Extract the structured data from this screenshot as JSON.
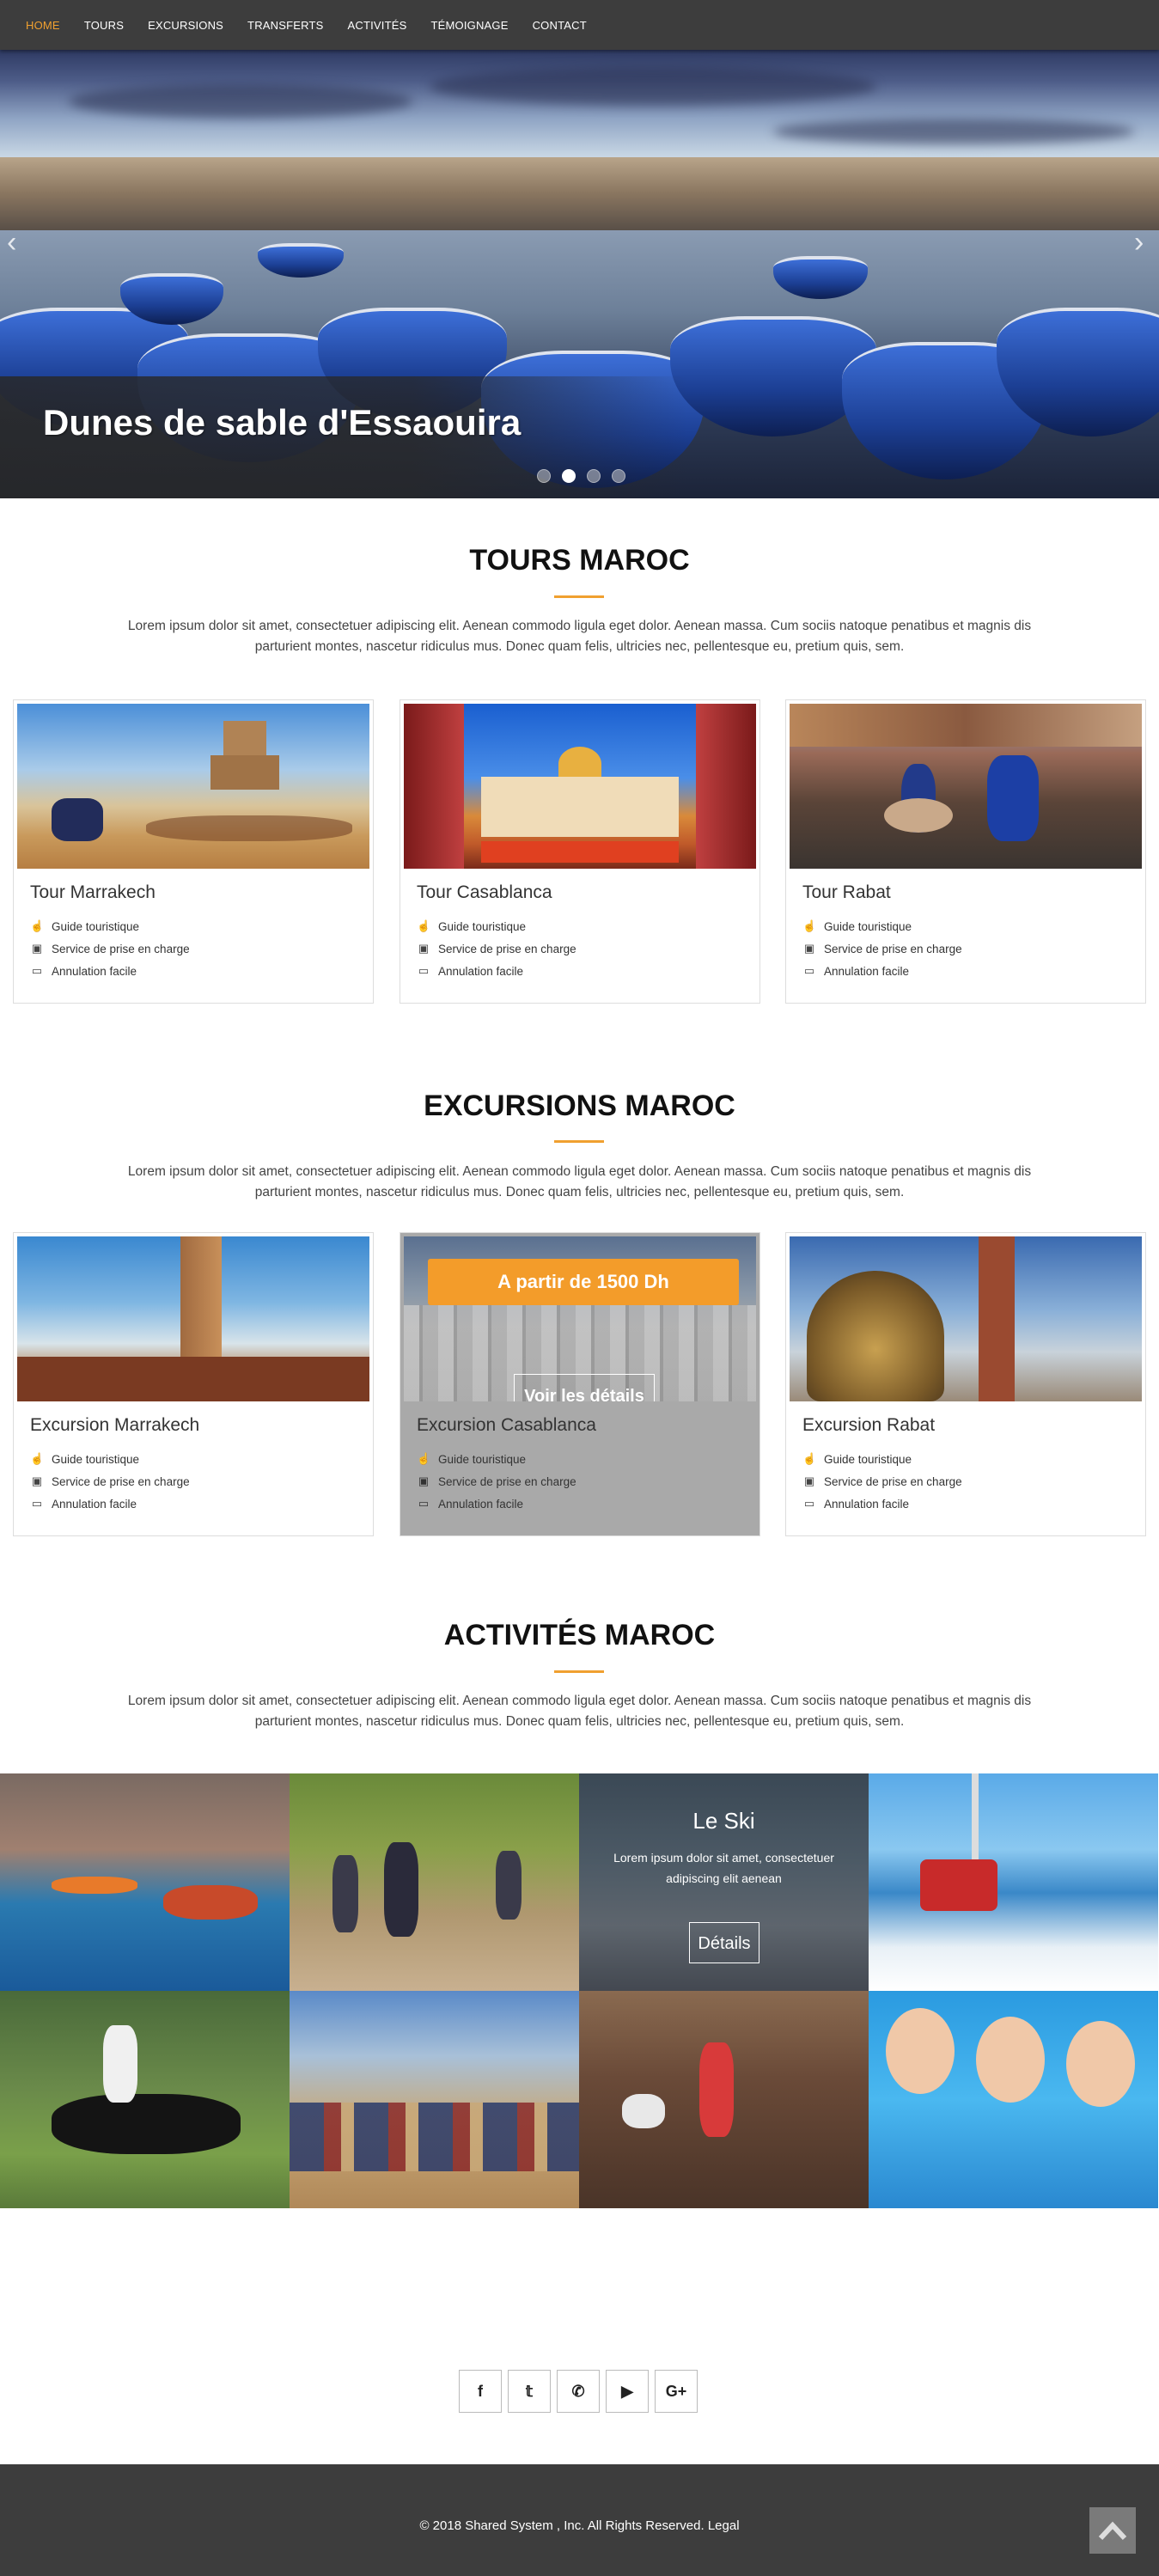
{
  "nav": {
    "items": [
      {
        "label": "HOME",
        "active": true
      },
      {
        "label": "TOURS"
      },
      {
        "label": "EXCURSIONS"
      },
      {
        "label": "TRANSFERTS"
      },
      {
        "label": "ACTIVITÉS"
      },
      {
        "label": "TÉMOIGNAGE"
      },
      {
        "label": "CONTACT"
      }
    ]
  },
  "hero": {
    "caption": "Dunes de sable d'Essaouira",
    "slides_count": 4,
    "active_slide": 2,
    "prev_icon": "chevron-left-icon",
    "next_icon": "chevron-right-icon"
  },
  "tours": {
    "title": "TOURS MAROC",
    "lead": "Lorem ipsum dolor sit amet, consectetuer adipiscing elit. Aenean commodo ligula eget dolor. Aenean massa. Cum sociis natoque penatibus et magnis dis parturient montes, nascetur ridiculus mus. Donec quam felis, ultricies nec, pellentesque eu, pretium quis, sem.",
    "cards": [
      {
        "title": "Tour Marrakech",
        "features": [
          "Guide touristique",
          "Service de prise en charge",
          "Annulation facile"
        ]
      },
      {
        "title": "Tour Casablanca",
        "features": [
          "Guide touristique",
          "Service de prise en charge",
          "Annulation facile"
        ]
      },
      {
        "title": "Tour Rabat",
        "features": [
          "Guide touristique",
          "Service de prise en charge",
          "Annulation facile"
        ]
      }
    ]
  },
  "excursions": {
    "title": "EXCURSIONS MAROC",
    "lead": "Lorem ipsum dolor sit amet, consectetuer adipiscing elit. Aenean commodo ligula eget dolor. Aenean massa. Cum sociis natoque penatibus et magnis dis parturient montes, nascetur ridiculus mus. Donec quam felis, ultricies nec, pellentesque eu, pretium quis, sem.",
    "cards": [
      {
        "title": "Excursion Marrakech",
        "features": [
          "Guide touristique",
          "Service de prise en charge",
          "Annulation facile"
        ]
      },
      {
        "title": "Excursion Casablanca",
        "features": [
          "Guide touristique",
          "Service de prise en charge",
          "Annulation facile"
        ],
        "price": "A partir de 1500 Dh",
        "details_label": "Voir les détails"
      },
      {
        "title": "Excursion Rabat",
        "features": [
          "Guide touristique",
          "Service de prise en charge",
          "Annulation facile"
        ]
      }
    ]
  },
  "activites": {
    "title": "ACTIVITÉS MAROC",
    "lead": "Lorem ipsum dolor sit amet, consectetuer adipiscing elit. Aenean commodo ligula eget dolor. Aenean massa. Cum sociis natoque penatibus et magnis dis parturient montes, nascetur ridiculus mus. Donec quam felis, ultricies nec, pellentesque eu, pretium quis, sem.",
    "ski": {
      "title": "Le Ski",
      "desc": "Lorem ipsum dolor sit amet, consectetuer adipiscing elit aenean",
      "button": "Détails"
    }
  },
  "social": {
    "icons": [
      "facebook-icon",
      "twitter-icon",
      "whatsapp-icon",
      "youtube-icon",
      "google-plus-icon"
    ],
    "glyphs": [
      "f",
      "𝕥",
      "✆",
      "▶",
      "G+"
    ]
  },
  "footer": {
    "copyright": "© 2018 Shared System , Inc. All Rights Reserved. Legal"
  },
  "colors": {
    "accent": "#f0a030",
    "nav_bg": "#3d3d3d",
    "badge": "#f39c2a"
  }
}
